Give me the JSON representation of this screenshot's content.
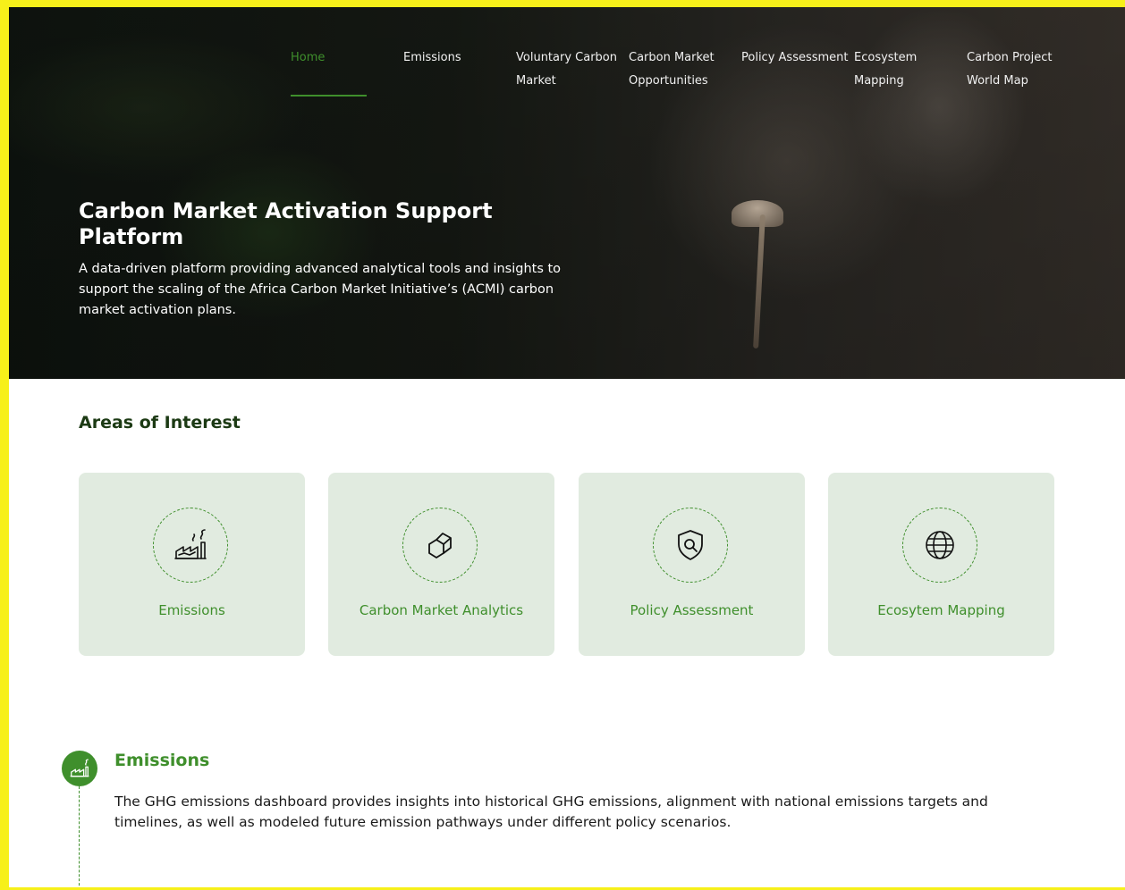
{
  "nav": {
    "items": [
      {
        "label": "Home",
        "active": true
      },
      {
        "label": "Emissions"
      },
      {
        "label": "Voluntary Carbon Market"
      },
      {
        "label": "Carbon Market Opportunities"
      },
      {
        "label": "Policy Assessment"
      },
      {
        "label": "Ecosystem Mapping"
      },
      {
        "label": "Carbon Project World Map"
      }
    ]
  },
  "hero": {
    "title": "Carbon Market Activation Support Platform",
    "description": "A data-driven platform providing advanced analytical tools and insights to support the scaling of the Africa Carbon Market Initiative’s (ACMI) carbon market activation plans."
  },
  "areas": {
    "title": "Areas of Interest",
    "cards": [
      {
        "label": "Emissions",
        "icon": "factory-emissions-icon"
      },
      {
        "label": "Carbon Market Analytics",
        "icon": "hexagon-cube-icon"
      },
      {
        "label": "Policy Assessment",
        "icon": "shield-search-icon"
      },
      {
        "label": "Ecosytem Mapping",
        "icon": "globe-icon"
      }
    ]
  },
  "emissions_section": {
    "title": "Emissions",
    "description": "The GHG emissions dashboard provides insights into historical GHG emissions, alignment with national emissions targets and timelines, as well as modeled future emission pathways under different policy scenarios.",
    "icon": "factory-emissions-icon"
  },
  "colors": {
    "accent": "#3f8f2c",
    "card_bg": "#e1ebe0",
    "heading_dark": "#1c3a14"
  }
}
